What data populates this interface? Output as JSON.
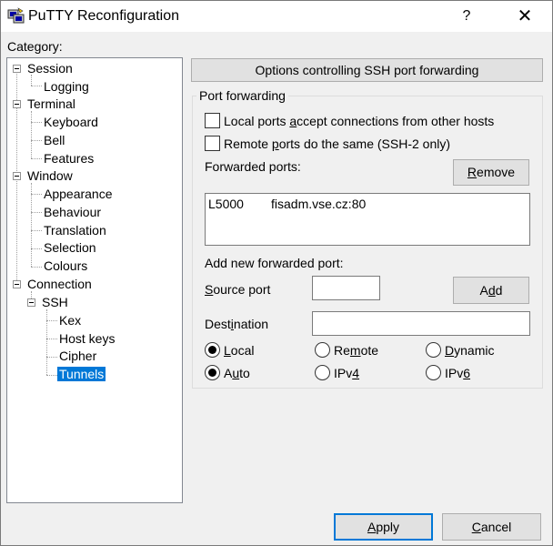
{
  "window": {
    "title": "PuTTY Reconfiguration",
    "help_label": "?",
    "close_label": "✕"
  },
  "category": {
    "label": "Category:",
    "tree": [
      {
        "label": "Session",
        "expanded": true
      },
      {
        "label": "Logging"
      },
      {
        "label": "Terminal",
        "expanded": true
      },
      {
        "label": "Keyboard"
      },
      {
        "label": "Bell"
      },
      {
        "label": "Features"
      },
      {
        "label": "Window",
        "expanded": true
      },
      {
        "label": "Appearance"
      },
      {
        "label": "Behaviour"
      },
      {
        "label": "Translation"
      },
      {
        "label": "Selection"
      },
      {
        "label": "Colours"
      },
      {
        "label": "Connection",
        "expanded": true
      },
      {
        "label": "SSH",
        "expanded": true
      },
      {
        "label": "Kex"
      },
      {
        "label": "Host keys"
      },
      {
        "label": "Cipher"
      },
      {
        "label": "Tunnels",
        "selected": true
      }
    ]
  },
  "panel": {
    "header": "Options controlling SSH port forwarding",
    "group_title": "Port forwarding",
    "local_ports_accept": {
      "label_pre": "Local ports ",
      "label_u": "a",
      "label_post": "ccept connections from other hosts",
      "checked": false
    },
    "remote_ports_same": {
      "label_pre": "Remote ",
      "label_u": "p",
      "label_post": "orts do the same (SSH-2 only)",
      "checked": false
    },
    "forwarded_ports_label": "Forwarded ports:",
    "remove_button": {
      "u": "R",
      "rest": "emove"
    },
    "forwarded_ports": [
      {
        "port": "L5000",
        "destination": "fisadm.vse.cz:80"
      }
    ],
    "add_new_label": "Add new forwarded port:",
    "source_port": {
      "u": "S",
      "rest": "ource port",
      "value": ""
    },
    "add_button": {
      "pre": "A",
      "u": "d",
      "post": "d"
    },
    "destination": {
      "pre": "Dest",
      "u": "i",
      "post": "nation",
      "value": ""
    },
    "direction": {
      "local": {
        "u": "L",
        "rest": "ocal",
        "checked": true
      },
      "remote": {
        "pre": "Re",
        "u": "m",
        "post": "ote",
        "checked": false
      },
      "dynamic": {
        "u": "D",
        "rest": "ynamic",
        "checked": false
      }
    },
    "protocol": {
      "auto": {
        "pre": "A",
        "u": "u",
        "post": "to",
        "checked": true
      },
      "ipv4": {
        "pre": "IPv",
        "u": "4",
        "post": "",
        "checked": false
      },
      "ipv6": {
        "pre": "IPv",
        "u": "6",
        "post": "",
        "checked": false
      }
    }
  },
  "footer": {
    "apply": {
      "u": "A",
      "rest": "pply"
    },
    "cancel": {
      "u": "C",
      "rest": "ancel"
    }
  }
}
